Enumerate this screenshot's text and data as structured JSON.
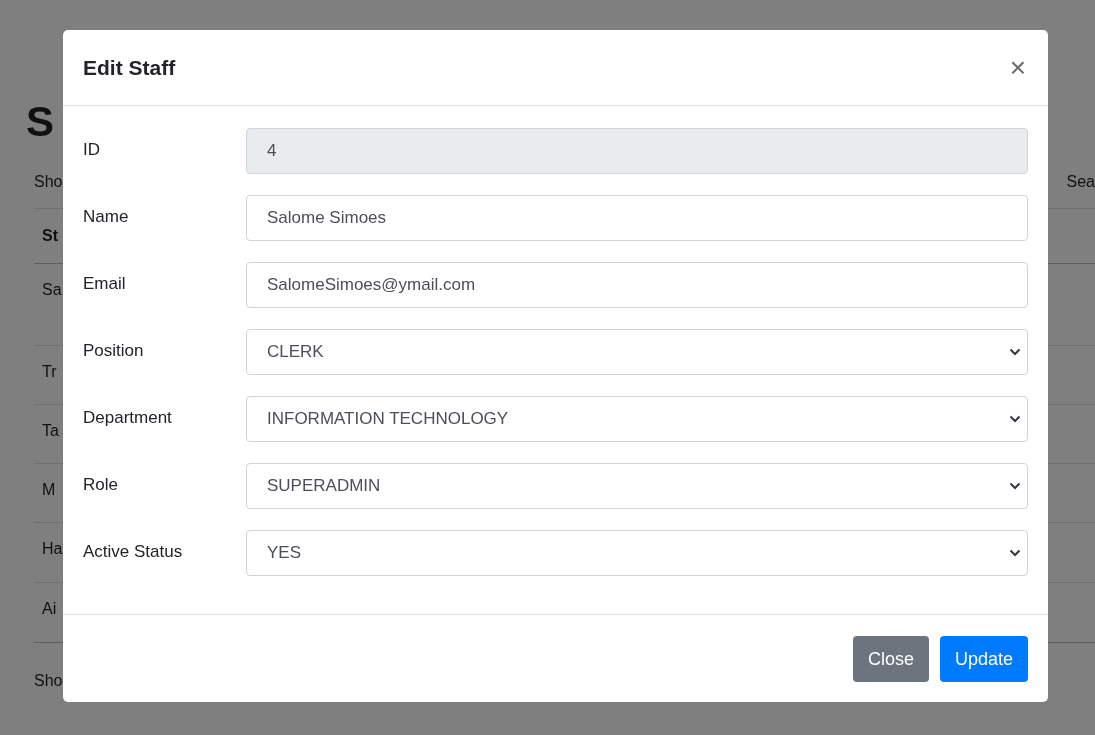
{
  "background_page": {
    "heading": "S",
    "length_label": "Sho",
    "search_label": "Sea",
    "table": {
      "column_1": "St",
      "rows": [
        "Sa",
        "Tr",
        "Ta",
        "M",
        "Ha",
        "Ai"
      ]
    },
    "info": "Sho"
  },
  "modal": {
    "title": "Edit Staff",
    "close_icon": "×",
    "fields": [
      {
        "label": "ID",
        "kind": "text",
        "value": "4",
        "disabled": true
      },
      {
        "label": "Name",
        "kind": "text",
        "value": "Salome Simoes",
        "disabled": false
      },
      {
        "label": "Email",
        "kind": "text",
        "value": "SalomeSimoes@ymail.com",
        "disabled": false
      },
      {
        "label": "Position",
        "kind": "select",
        "value": "CLERK",
        "disabled": false
      },
      {
        "label": "Department",
        "kind": "select",
        "value": "INFORMATION TECHNOLOGY",
        "disabled": false
      },
      {
        "label": "Role",
        "kind": "select",
        "value": "SUPERADMIN",
        "disabled": false
      },
      {
        "label": "Active Status",
        "kind": "select",
        "value": "YES",
        "disabled": false
      }
    ],
    "buttons": [
      {
        "label": "Close",
        "kind": "secondary"
      },
      {
        "label": "Update",
        "kind": "primary"
      }
    ]
  }
}
